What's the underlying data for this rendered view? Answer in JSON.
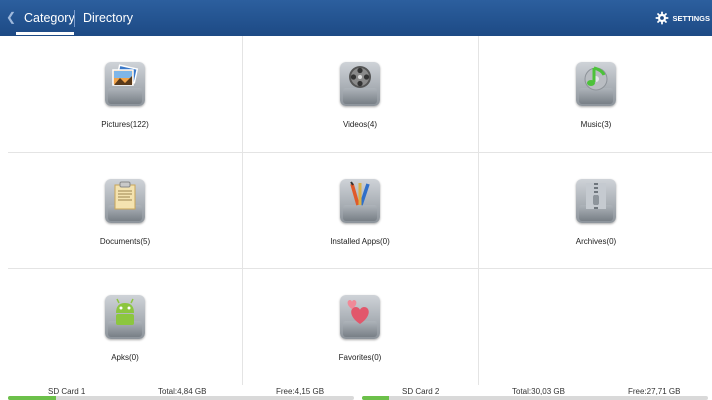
{
  "header": {
    "back_icon": "chevron-left",
    "tabs": [
      {
        "label": "Category",
        "active": true
      },
      {
        "label": "Directory",
        "active": false
      }
    ],
    "settings_label": "SETTINGS",
    "colors": {
      "bar": "#1d4a85"
    }
  },
  "categories": [
    {
      "label": "Pictures(122)",
      "icon": "pictures-icon"
    },
    {
      "label": "Videos(4)",
      "icon": "film-reel-icon"
    },
    {
      "label": "Music(3)",
      "icon": "music-note-icon"
    },
    {
      "label": "Documents(5)",
      "icon": "document-icon"
    },
    {
      "label": "Installed Apps(0)",
      "icon": "pencils-icon"
    },
    {
      "label": "Archives(0)",
      "icon": "zipper-icon"
    },
    {
      "label": "Apks(0)",
      "icon": "android-icon"
    },
    {
      "label": "Favorites(0)",
      "icon": "hearts-icon"
    }
  ],
  "storage": [
    {
      "name": "SD Card 1",
      "total": "Total:4,84 GB",
      "free": "Free:4,15 GB",
      "used_fraction": 0.14
    },
    {
      "name": "SD Card 2",
      "total": "Total:30,03 GB",
      "free": "Free:27,71 GB",
      "used_fraction": 0.077
    }
  ]
}
